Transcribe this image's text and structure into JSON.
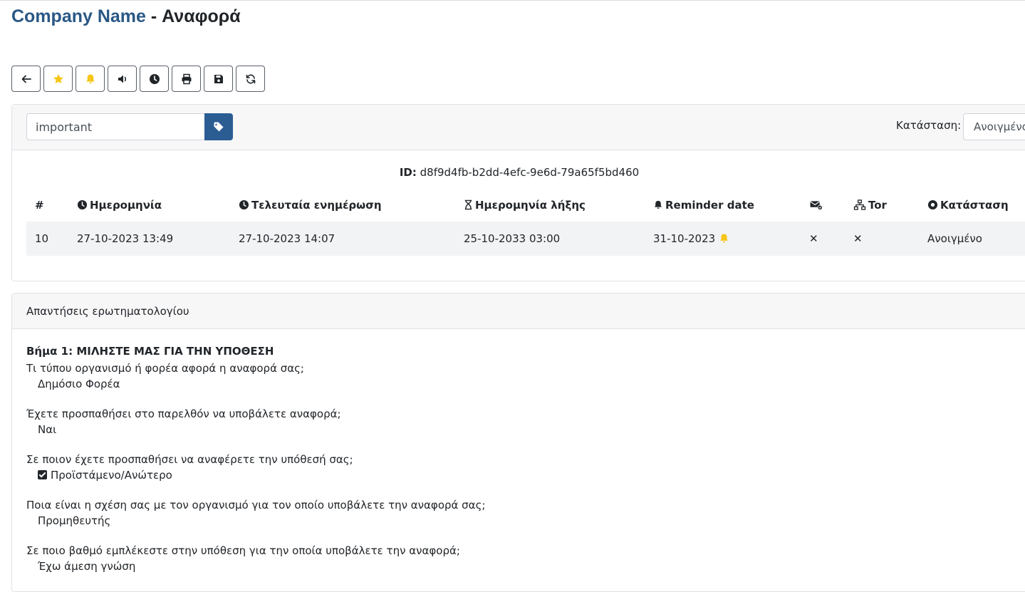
{
  "header": {
    "company": "Company Name",
    "separator": " - ",
    "page": "Αναφορά"
  },
  "toolbar": {
    "buttons": [
      "back-arrow-icon",
      "star-icon",
      "bell-icon",
      "volume-icon",
      "clock-icon",
      "print-icon",
      "save-icon",
      "refresh-icon"
    ],
    "accent_star": "#f5c518",
    "accent_bell": "#f5c518"
  },
  "tags": {
    "value": "important",
    "button_color": "#2b5d93"
  },
  "status": {
    "label": "Κατάσταση:",
    "selected": "Ανοιγμένο"
  },
  "report": {
    "id_label": "ID:",
    "id_value": "d8f9d4fb-b2dd-4efc-9e6d-79a65f5bd460",
    "columns": {
      "num": "#",
      "date": "Ημερομηνία",
      "updated": "Τελευταία ενημέρωση",
      "expiry": "Ημερομηνία λήξης",
      "reminder": "Reminder date",
      "tor": "Tor",
      "status": "Κατάσταση"
    },
    "row": {
      "num": "10",
      "date": "27-10-2023 13:49",
      "updated": "27-10-2023 14:07",
      "expiry": "25-10-2033 03:00",
      "reminder": "31-10-2023",
      "notified": "✕",
      "tor": "✕",
      "status": "Ανοιγμένο"
    }
  },
  "questionnaire": {
    "title": "Απαντήσεις ερωτηματολογίου",
    "step": "Βήμα 1: ΜΙΛΗΣΤΕ ΜΑΣ ΓΙΑ ΤΗΝ ΥΠΟΘΕΣΗ",
    "q1": "Τι τύπου οργανισμό ή φορέα αφορά η αναφορά σας;",
    "a1": "Δημόσιο Φορέα",
    "q2": "Έχετε προσπαθήσει στο παρελθόν να υποβάλετε αναφορά;",
    "a2": "Ναι",
    "q3": "Σε ποιον έχετε προσπαθήσει να αναφέρετε την υπόθεσή σας;",
    "a3": "Προϊστάμενο/Ανώτερο",
    "q4": "Ποια είναι η σχέση σας με τον οργανισμό για τον οποίο υποβάλετε την αναφορά σας;",
    "a4": "Προμηθευτής",
    "q5": "Σε ποιο βαθμό εμπλέκεστε στην υπόθεση για την οποία υποβάλετε την αναφορά;",
    "a5": "Έχω άμεση γνώση"
  }
}
